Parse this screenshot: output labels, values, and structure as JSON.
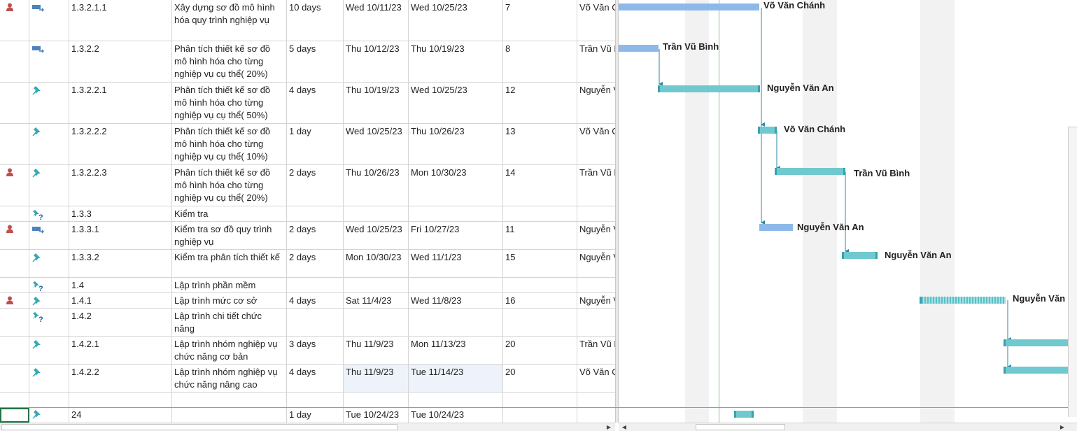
{
  "rows": [
    {
      "id": "1.3.2.1.1",
      "name": "Xây dựng sơ đồ mô hình hóa quy trình nghiệp vụ",
      "duration": "10 days",
      "start": "Wed 10/11/23",
      "finish": "Wed 10/25/23",
      "pred": "7",
      "resource": "Võ Văn Chánh",
      "ind": "person-icon",
      "mode": "auto-scheduled-icon"
    },
    {
      "id": "1.3.2.2",
      "name": "Phân tích thiết kế sơ đồ mô hình hóa cho từng nghiệp vụ cụ thể( 20%)",
      "duration": "5 days",
      "start": "Thu 10/12/23",
      "finish": "Thu 10/19/23",
      "pred": "8",
      "resource": "Trần Vũ Bình",
      "ind": "",
      "mode": "auto-scheduled-icon"
    },
    {
      "id": "1.3.2.2.1",
      "name": "Phân tích thiết kế sơ đồ mô hình hóa cho từng nghiệp vụ cụ thể( 50%)",
      "duration": "4 days",
      "start": "Thu 10/19/23",
      "finish": "Wed 10/25/23",
      "pred": "12",
      "resource": "Nguyễn Văn An",
      "ind": "",
      "mode": "manual-pin-icon"
    },
    {
      "id": "1.3.2.2.2",
      "name": "Phân tích thiết kế sơ đồ mô hình hóa cho từng nghiệp vụ cụ thể( 10%)",
      "duration": "1 day",
      "start": "Wed 10/25/23",
      "finish": "Thu 10/26/23",
      "pred": "13",
      "resource": "Võ Văn Chánh",
      "ind": "",
      "mode": "manual-pin-icon"
    },
    {
      "id": "1.3.2.2.3",
      "name": "Phân tích thiết kế sơ đồ mô hình hóa cho từng nghiệp vụ cụ thể( 20%)",
      "duration": "2 days",
      "start": "Thu 10/26/23",
      "finish": "Mon 10/30/23",
      "pred": "14",
      "resource": "Trần Vũ Bình",
      "ind": "person-icon",
      "mode": "manual-pin-icon"
    },
    {
      "id": "1.3.3",
      "name": "Kiểm tra",
      "duration": "",
      "start": "",
      "finish": "",
      "pred": "",
      "resource": "",
      "ind": "",
      "mode": "manual-unknown-icon"
    },
    {
      "id": "1.3.3.1",
      "name": "Kiểm tra sơ đồ quy trình nghiệp vụ",
      "duration": "2 days",
      "start": "Wed 10/25/23",
      "finish": "Fri 10/27/23",
      "pred": "11",
      "resource": "Nguyễn Văn An",
      "ind": "person-icon",
      "mode": "auto-scheduled-icon"
    },
    {
      "id": "1.3.3.2",
      "name": "Kiểm tra phân tích thiết kế",
      "duration": "2 days",
      "start": "Mon 10/30/23",
      "finish": "Wed 11/1/23",
      "pred": "15",
      "resource": "Nguyễn Văn An",
      "ind": "",
      "mode": "manual-pin-icon"
    },
    {
      "id": "1.4",
      "name": "Lập trình phần mềm",
      "duration": "",
      "start": "",
      "finish": "",
      "pred": "",
      "resource": "",
      "ind": "",
      "mode": "manual-unknown-icon"
    },
    {
      "id": "1.4.1",
      "name": "Lập trình mức cơ sở",
      "duration": "4 days",
      "start": "Sat 11/4/23",
      "finish": "Wed 11/8/23",
      "pred": "16",
      "resource": "Nguyễn Văn An",
      "ind": "person-icon",
      "mode": "manual-pin-icon"
    },
    {
      "id": "1.4.2",
      "name": "Lập trình chi tiết chức năng",
      "duration": "",
      "start": "",
      "finish": "",
      "pred": "",
      "resource": "",
      "ind": "",
      "mode": "manual-unknown-icon"
    },
    {
      "id": "1.4.2.1",
      "name": "Lập trình nhóm nghiệp vụ chức năng cơ bản",
      "duration": "3 days",
      "start": "Thu 11/9/23",
      "finish": "Mon 11/13/23",
      "pred": "20",
      "resource": "Trần Vũ Bình",
      "ind": "",
      "mode": "manual-pin-icon"
    },
    {
      "id": "1.4.2.2",
      "name": "Lập trình nhóm nghiệp vụ chức năng nâng cao",
      "duration": "4 days",
      "start": "Thu 11/9/23",
      "finish": "Tue 11/14/23",
      "pred": "20",
      "resource": "Võ Văn Chánh",
      "ind": "",
      "mode": "manual-pin-icon"
    },
    {
      "id": "",
      "name": "",
      "duration": "",
      "start": "",
      "finish": "",
      "pred": "",
      "resource": "",
      "ind": "",
      "mode": ""
    }
  ],
  "bottom_row": {
    "id": "24",
    "name": "",
    "duration": "1 day",
    "start": "Tue 10/24/23",
    "finish": "Tue 10/24/23",
    "pred": "",
    "resource": "",
    "mode": "manual-pin-icon"
  },
  "gantt_labels": [
    "Võ Văn Chánh",
    "Trần Vũ Bình",
    "Nguyễn Văn An",
    "Võ Văn Chánh",
    "Trần Vũ Bình",
    "Nguyễn Văn An",
    "Nguyễn Văn An",
    "Nguyễn Văn"
  ],
  "colors": {
    "auto_bar": "#8db9ea",
    "manual_bar": "#70c9cf",
    "link": "#2e86a8",
    "grid_line": "#d4d4d4"
  }
}
